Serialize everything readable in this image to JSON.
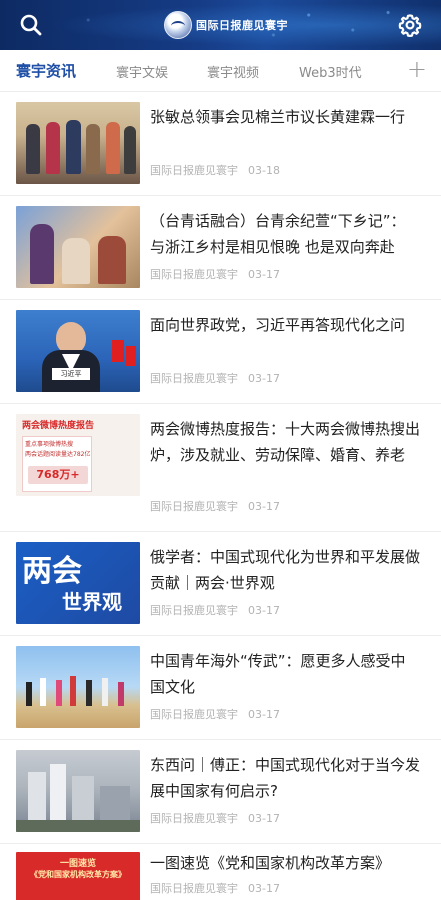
{
  "header": {
    "logo_text": "国际日报鹿见寰宇",
    "search_icon": "search-icon",
    "settings_icon": "gear-icon"
  },
  "tabs": [
    {
      "label": "寰宇资讯",
      "active": true
    },
    {
      "label": "寰宇文娱",
      "active": false
    },
    {
      "label": "寰宇视频",
      "active": false
    },
    {
      "label": "Web3时代",
      "active": false
    }
  ],
  "add_tab_label": "+",
  "articles": [
    {
      "title": "张敏总领事会见棉兰市议长黄建霖一行",
      "source": "国际日报鹿见寰宇",
      "date": "03-18"
    },
    {
      "title": "（台青话融合）台青余纪萱“下乡记”：与浙江乡村是相见恨晚 也是双向奔赴",
      "source": "国际日报鹿见寰宇",
      "date": "03-17"
    },
    {
      "title": "面向世界政党，习近平再答现代化之问",
      "source": "国际日报鹿见寰宇",
      "date": "03-17"
    },
    {
      "title": "两会微博热度报告：十大两会微博热搜出炉，涉及就业、劳动保障、婚育、养老",
      "source": "国际日报鹿见寰宇",
      "date": "03-17"
    },
    {
      "title": "俄学者：中国式现代化为世界和平发展做贡献｜两会·世界观",
      "source": "国际日报鹿见寰宇",
      "date": "03-17"
    },
    {
      "title": "中国青年海外“传武”：愿更多人感受中国文化",
      "source": "国际日报鹿见寰宇",
      "date": "03-17"
    },
    {
      "title": "东西问｜傅正：中国式现代化对于当今发展中国家有何启示?",
      "source": "国际日报鹿见寰宇",
      "date": "03-17"
    },
    {
      "title": "一图速览《党和国家机构改革方案》",
      "source": "国际日报鹿见寰宇",
      "date": "03-17"
    }
  ],
  "thumb_text": {
    "report_heading": "两会微博热度报告",
    "report_line1": "重点事项微博热搜",
    "report_line2": "两会话题阅读量达782亿",
    "report_number": "768万+",
    "lianghui": "两会",
    "shijieguan": "世界观",
    "xi_nameplate": "习近平",
    "tusu_line1": "一图速览",
    "tusu_line2": "《党和国家机构改革方案》"
  },
  "colors": {
    "header_bg": "#163c86",
    "tab_active": "#1f4fa6",
    "tab_inactive": "#8a8a8a",
    "meta_text": "#b3b3b3"
  }
}
